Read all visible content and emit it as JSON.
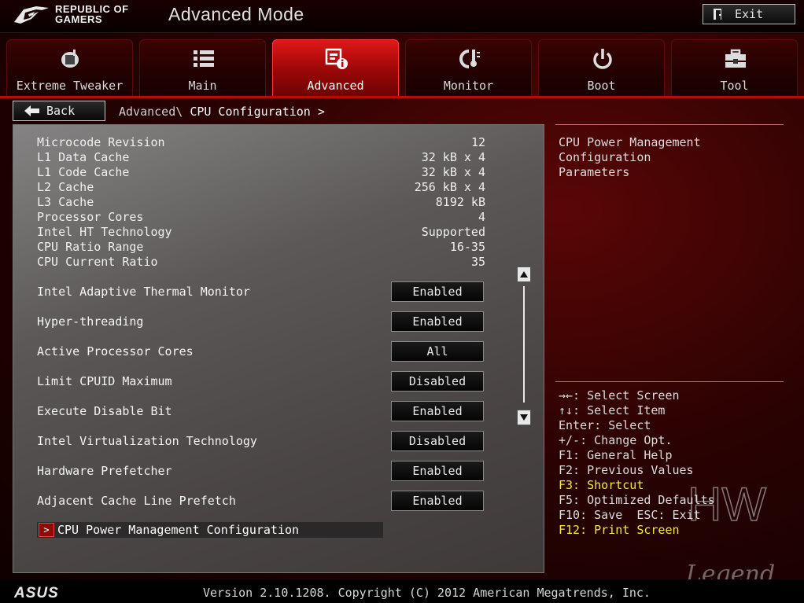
{
  "header": {
    "brand_line1": "REPUBLIC OF",
    "brand_line2": "GAMERS",
    "mode_title": "Advanced Mode",
    "exit_label": "Exit"
  },
  "tabs": [
    {
      "label": "Extreme Tweaker",
      "icon": "tweaker-icon",
      "active": false
    },
    {
      "label": "Main",
      "icon": "list-icon",
      "active": false
    },
    {
      "label": "Advanced",
      "icon": "advanced-info-icon",
      "active": true
    },
    {
      "label": "Monitor",
      "icon": "monitor-gauge-icon",
      "active": false
    },
    {
      "label": "Boot",
      "icon": "power-icon",
      "active": false
    },
    {
      "label": "Tool",
      "icon": "toolbox-icon",
      "active": false
    }
  ],
  "nav": {
    "back_label": "Back",
    "crumb_parent": "Advanced\\",
    "crumb_current": "CPU Configuration",
    "crumb_arrow": ">"
  },
  "info_rows": [
    {
      "key": "Microcode Revision",
      "value": "12"
    },
    {
      "key": "L1 Data Cache",
      "value": "32 kB x 4"
    },
    {
      "key": "L1 Code Cache",
      "value": "32 kB x 4"
    },
    {
      "key": "L2 Cache",
      "value": "256 kB x 4"
    },
    {
      "key": "L3 Cache",
      "value": "8192 kB"
    },
    {
      "key": "Processor Cores",
      "value": "4"
    },
    {
      "key": "Intel HT Technology",
      "value": "Supported"
    },
    {
      "key": "CPU Ratio Range",
      "value": "16-35"
    },
    {
      "key": "CPU Current Ratio",
      "value": "35"
    }
  ],
  "options": [
    {
      "label": "Intel Adaptive Thermal Monitor",
      "value": "Enabled"
    },
    {
      "label": "Hyper-threading",
      "value": "Enabled"
    },
    {
      "label": "Active Processor Cores",
      "value": "All"
    },
    {
      "label": "Limit CPUID Maximum",
      "value": "Disabled"
    },
    {
      "label": "Execute Disable Bit",
      "value": "Enabled"
    },
    {
      "label": "Intel Virtualization Technology",
      "value": "Disabled"
    },
    {
      "label": "Hardware Prefetcher",
      "value": "Enabled"
    },
    {
      "label": "Adjacent Cache Line Prefetch",
      "value": "Enabled"
    }
  ],
  "submenu": {
    "arrow": ">",
    "label": "CPU Power Management Configuration"
  },
  "help": {
    "line1": "CPU Power Management Configuration",
    "line2": "Parameters"
  },
  "keys": [
    {
      "text": "→←: Select Screen",
      "highlight": false
    },
    {
      "text": "↑↓: Select Item",
      "highlight": false
    },
    {
      "text": "Enter: Select",
      "highlight": false
    },
    {
      "text": "+/-: Change Opt.",
      "highlight": false
    },
    {
      "text": "F1: General Help",
      "highlight": false
    },
    {
      "text": "F2: Previous Values",
      "highlight": false
    },
    {
      "text": "F3: Shortcut",
      "highlight": true
    },
    {
      "text": "F5: Optimized Defaults",
      "highlight": false
    },
    {
      "text": "F10: Save  ESC: Exit",
      "highlight": false
    },
    {
      "text": "F12: Print Screen",
      "highlight": true
    }
  ],
  "watermark": {
    "line1": "HW",
    "line2": "Legend"
  },
  "footer": {
    "logo_text": "ASUS",
    "version": "Version 2.10.1208. Copyright (C) 2012 American Megatrends, Inc."
  },
  "colors": {
    "accent_red": "#b50d0d",
    "highlight_yellow": "#f5e93c",
    "active_tab": "#e01818"
  }
}
